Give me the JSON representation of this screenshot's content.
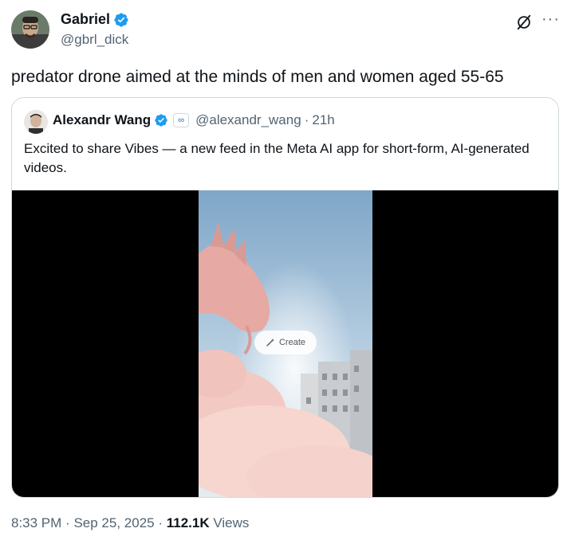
{
  "tweet": {
    "author_name": "Gabriel",
    "author_handle": "@gbrl_dick",
    "text": "predator drone aimed at the minds of men and women aged 55-65"
  },
  "quoted_tweet": {
    "author_name": "Alexandr Wang",
    "author_handle": "@alexandr_wang",
    "separator": "·",
    "time_ago": "21h",
    "text": "Excited to share Vibes — a new feed in the Meta AI app for short-form, AI-generated videos.",
    "affiliate_badge": "∞",
    "media": {
      "create_button_label": "Create"
    }
  },
  "footer": {
    "time": "8:33 PM",
    "separator_1": "·",
    "date": "Sep 25, 2025",
    "separator_2": "·",
    "views_count": "112.1K",
    "views_label": "Views"
  },
  "colors": {
    "verified_blue": "#1d9bf0",
    "secondary_text": "#536471",
    "border": "#cfd9de"
  },
  "icons": {
    "verified": "verified-badge-icon",
    "grok": "grok-icon",
    "more": "more-options-icon",
    "create": "magic-wand-icon"
  },
  "more_label": "···"
}
